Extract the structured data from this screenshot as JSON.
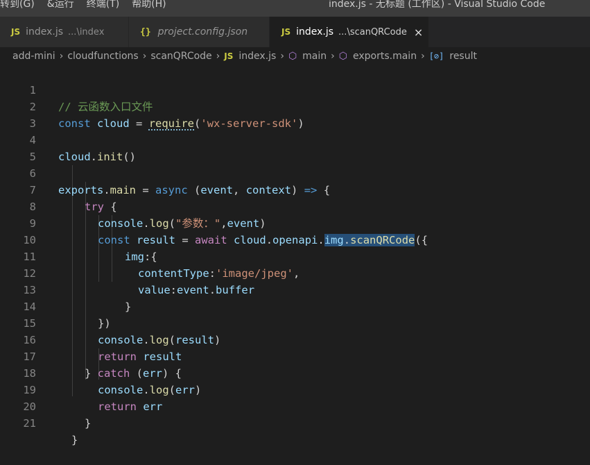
{
  "menu": {
    "goto": "转到(G)",
    "run": "&运行",
    "terminal": "终端(T)",
    "help": "帮助(H)"
  },
  "window_title": "index.js - 无标题 (工作区) - Visual Studio Code",
  "tabs": [
    {
      "icon": "JS",
      "label": "index.js",
      "desc": "...\\index"
    },
    {
      "icon": "{}",
      "label": "project.config.json"
    },
    {
      "icon": "JS",
      "label": "index.js",
      "desc": "...\\scanQRCode",
      "close": "×"
    }
  ],
  "breadcrumb": {
    "items": [
      "add-mini",
      "cloudfunctions",
      "scanQRCode"
    ],
    "file_icon": "JS",
    "file": "index.js",
    "main": "main",
    "exports_main": "exports.main",
    "field_icon": "[⊘]",
    "result": "result",
    "sep": "›"
  },
  "code": {
    "numbers": [
      "1",
      "2",
      "3",
      "4",
      "5",
      "6",
      "7",
      "8",
      "9",
      "10",
      "11",
      "12",
      "13",
      "14",
      "15",
      "16",
      "17",
      "18",
      "19",
      "20",
      "21"
    ],
    "l1": "// 云函数入口文件",
    "l2": {
      "kw": "const",
      "var": "cloud",
      "eq": " = ",
      "fn": "require",
      "open": "(",
      "str": "'wx-server-sdk'",
      "close": ")"
    },
    "l4": {
      "var": "cloud",
      "dot": ".",
      "fn": "init",
      "parens": "()"
    },
    "l6": {
      "obj": "exports",
      "dot": ".",
      "fn": "main",
      "eq": " = ",
      "async": "async",
      "open": " (",
      "p1": "event",
      "comma": ", ",
      "p2": "context",
      "close": ") ",
      "arrow": "=>",
      "brace": " {"
    },
    "l7": {
      "kw": "try",
      "brace": " {"
    },
    "l8": {
      "obj": "console",
      "dot": ".",
      "fn": "log",
      "open": "(",
      "str": "\"参数：\"",
      "comma": ",",
      "arg": "event",
      "close": ")"
    },
    "l9": {
      "kw": "const",
      "var": "result",
      "eq": " = ",
      "await": "await",
      "sp": " ",
      "obj1": "cloud",
      "d1": ".",
      "obj2": "openapi",
      "d2": ".",
      "obj3": "img",
      "d3": ".",
      "fn": "scanQRCode",
      "open": "({"
    },
    "l10": {
      "prop": "img",
      "rest": ":{"
    },
    "l11": {
      "prop": "contentType",
      "colon": ":",
      "str": "'image/jpeg'",
      "comma": ","
    },
    "l12": {
      "prop": "value",
      "colon": ":",
      "obj": "event",
      "dot": ".",
      "field": "buffer"
    },
    "l13": "}",
    "l14": "})",
    "l15": {
      "obj": "console",
      "dot": ".",
      "fn": "log",
      "open": "(",
      "arg": "result",
      "close": ")"
    },
    "l16": {
      "kw": "return",
      "sp": " ",
      "arg": "result"
    },
    "l17": {
      "b1": "} ",
      "kw": "catch",
      "open": " (",
      "arg": "err",
      "close": ") {"
    },
    "l18": {
      "obj": "console",
      "dot": ".",
      "fn": "log",
      "open": "(",
      "arg": "err",
      "close": ")"
    },
    "l19": {
      "kw": "return",
      "sp": " ",
      "arg": "err"
    },
    "l20": "}",
    "l21": "}"
  },
  "colors": {
    "keyword": "#569cd6",
    "control": "#c586c0",
    "string": "#ce9178",
    "function": "#dcdcaa",
    "variable": "#9cdcfe",
    "comment": "#6a9955",
    "highlight": "#264f78",
    "background": "#1e1e1e"
  }
}
